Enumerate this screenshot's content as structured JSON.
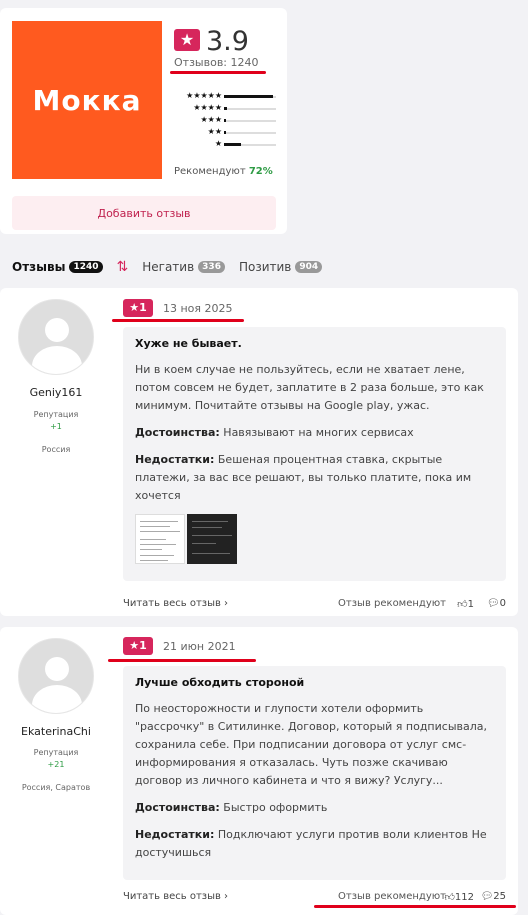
{
  "summary": {
    "logo_text": "Мокка",
    "rating": "3.9",
    "reviews_label": "Отзывов: 1240",
    "distribution": [
      {
        "stars": "★★★★★",
        "fill": 0.95
      },
      {
        "stars": "★★★★",
        "fill": 0.06
      },
      {
        "stars": "★★★",
        "fill": 0.04
      },
      {
        "stars": "★★",
        "fill": 0.03
      },
      {
        "stars": "★",
        "fill": 0.32
      }
    ],
    "recommend_label": "Рекомендуют",
    "recommend_value": "72%",
    "add_review": "Добавить отзыв",
    "colors": {
      "brand": "#ff5a1f",
      "accent": "#d6265c",
      "positive": "#2e9b44"
    }
  },
  "tabs": [
    {
      "label": "Отзывы",
      "count": "1240",
      "active": true
    },
    {
      "label": "Негатив",
      "count": "336",
      "active": false
    },
    {
      "label": "Позитив",
      "count": "904",
      "active": false
    }
  ],
  "reviews": [
    {
      "user": "Geniy161",
      "reputation_label": "Репутация",
      "reputation": "+1",
      "location": "Россия",
      "rating": "1",
      "date": "13 ноя 2025",
      "title": "Хуже не бывает.",
      "text": "Ни в коем случае не пользуйтесь, если не хватает лене, потом совсем не будет, заплатите в 2 раза больше, это как минимум. Почитайте отзывы на Google play, ужас.",
      "pros_label": "Достоинства:",
      "pros": "Навязывают на многих сервисах",
      "cons_label": "Недостатки:",
      "cons": "Бешеная процентная ставка, скрытые платежи, за вас все решают, вы только платите, пока им хочется",
      "read_more": "Читать весь отзыв",
      "recommend": "Отзыв рекомендуют",
      "likes": "1",
      "comments": "0"
    },
    {
      "user": "EkaterinaChi",
      "reputation_label": "Репутация",
      "reputation": "+21",
      "location": "Россия, Саратов",
      "rating": "1",
      "date": "21 июн 2021",
      "title": "Лучше обходить стороной",
      "text": "По неосторожности и глупости хотели оформить \"рассрочку\" в Ситилинке. Договор, который я подписывала, сохранила себе. При подписании договора от услуг смс-информирования я отказалась. Чуть позже скачиваю договор из личного кабинета и что я вижу? Услугу...",
      "pros_label": "Достоинства:",
      "pros": "Быстро оформить",
      "cons_label": "Недостатки:",
      "cons": "Подключают услуги против воли клиентов Не достучишься",
      "read_more": "Читать весь отзыв",
      "recommend": "Отзыв рекомендуют",
      "likes": "112",
      "comments": "25"
    }
  ]
}
